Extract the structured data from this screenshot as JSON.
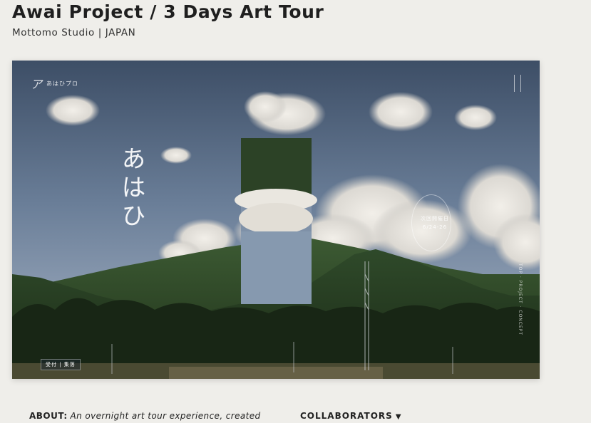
{
  "header": {
    "title": "Awai Project / 3 Days Art Tour",
    "subtitle": "Mottomo Studio  |  JAPAN"
  },
  "hero": {
    "logo_glyph": "ア",
    "logo_text": "あはひプロ",
    "calligraphy": "あはひ",
    "badge_line1": "次回開催日",
    "badge_line2": "6/24-26",
    "side_text": "TOP · PROJECT · CONCEPT",
    "tag": "受付 | 集落"
  },
  "about": {
    "label": "ABOUT:",
    "text": "An overnight art tour experience, created"
  },
  "collaborators": {
    "label": "COLLABORATORS",
    "arrow": "▼"
  }
}
